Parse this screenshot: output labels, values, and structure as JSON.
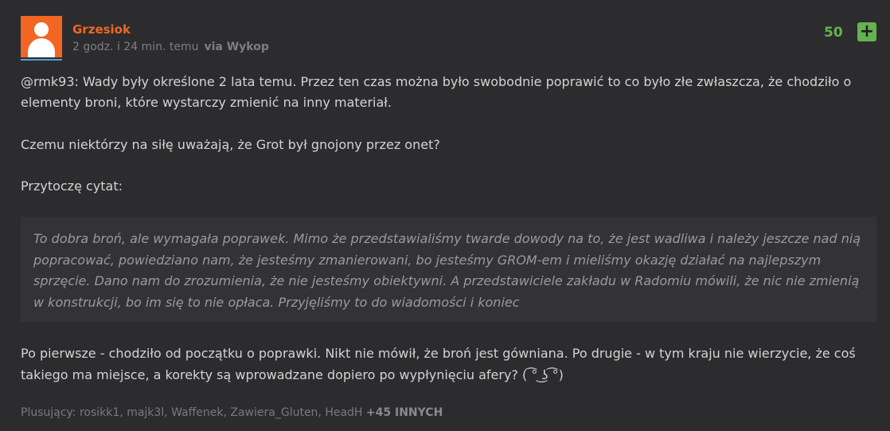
{
  "entry": {
    "author": "Grzesiok",
    "time": "2 godz. i 24 min. temu",
    "via": "via Wykop",
    "votes": "50",
    "plus_label": "+",
    "mention": "@rmk93",
    "p1_rest": ": Wady były określone 2 lata temu. Przez ten czas można było swobodnie poprawić to co było złe zwłaszcza, że chodziło o elementy broni, które wystarczy zmienić na inny materiał.",
    "p2": "Czemu niektórzy na siłę uważają, że Grot był gnojony przez onet?",
    "p3": "Przytoczę cytat:",
    "quote": "To dobra broń, ale wymagała poprawek. Mimo że przedstawialiśmy twarde dowody na to, że jest wadliwa i należy jeszcze nad nią popracować, powiedziano nam, że jesteśmy zmanierowani, bo jesteśmy GROM-em i mieliśmy okazję działać na najlepszym sprzęcie. Dano nam do zrozumienia, że nie jesteśmy obiektywni. A przedstawiciele zakładu w Radomiu mówili, że nic nie zmienią w konstrukcji, bo im się to nie opłaca. Przyjęliśmy to do wiadomości i koniec",
    "p4": "Po pierwsze - chodziło od początku o poprawki. Nikt nie mówił, że broń jest gówniana. Po drugie - w tym kraju nie wierzycie, że coś takiego ma miejsce, a korekty są wprowadzane dopiero po wypłynięciu afery? ( ͡° ͜ʖ ͡°)",
    "voters_label": "Plusujący: rosikk1, majk3l, Waffenek, Zawiera_Gluten, HeadH",
    "voters_more": "+45 INNYCH"
  },
  "colors": {
    "author": "#f26522",
    "votes": "#67b14f",
    "background": "#2c2c2e"
  },
  "icons": {
    "avatar": "default-user-avatar-icon",
    "plus": "plus-icon"
  }
}
